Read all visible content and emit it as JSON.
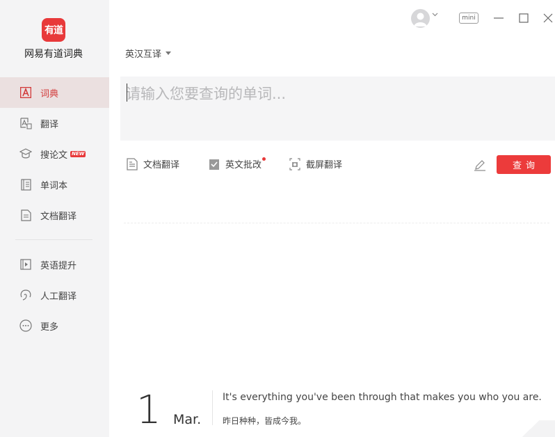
{
  "app": {
    "logo_text": "有道",
    "name": "网易有道词典"
  },
  "sidebar": {
    "items": [
      {
        "label": "词典",
        "icon": "dictionary-icon",
        "active": true
      },
      {
        "label": "翻译",
        "icon": "translate-icon"
      },
      {
        "label": "搜论文",
        "icon": "graduation-cap-icon",
        "badge": "NEW"
      },
      {
        "label": "单词本",
        "icon": "wordbook-icon"
      },
      {
        "label": "文档翻译",
        "icon": "document-icon"
      }
    ],
    "items2": [
      {
        "label": "英语提升",
        "icon": "play-video-icon"
      },
      {
        "label": "人工翻译",
        "icon": "headset-icon"
      },
      {
        "label": "更多",
        "icon": "more-icon"
      }
    ]
  },
  "titlebar": {
    "mini_label": "mini"
  },
  "lang": {
    "selected": "英汉互译"
  },
  "search": {
    "placeholder": "请输入您要查询的单词..."
  },
  "toolbar": {
    "doc_translate": "文档翻译",
    "english_review": "英文批改",
    "screenshot_translate": "截屏翻译",
    "search_button": "查询"
  },
  "daily": {
    "day": "1",
    "month": "Mar.",
    "sentence_en": "It's everything you've been through that makes you who you are.",
    "sentence_zh": "昨日种种，皆成今我。"
  },
  "colors": {
    "accent": "#ec3b3b",
    "sidebar_bg": "#f4f4f5",
    "active_bg": "#ebe0e0"
  }
}
